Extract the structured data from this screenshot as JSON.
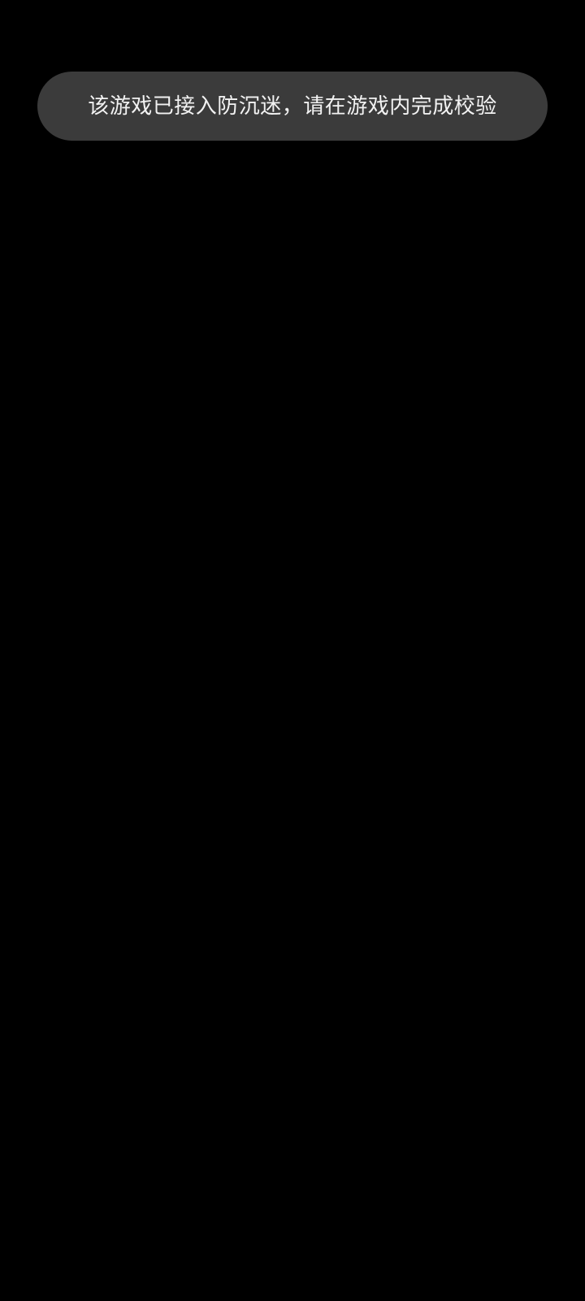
{
  "toast": {
    "message": "该游戏已接入防沉迷，请在游戏内完成校验"
  },
  "colors": {
    "background": "#000000",
    "toast_background": "#3b3b3b",
    "toast_text": "#f2f2f2"
  }
}
